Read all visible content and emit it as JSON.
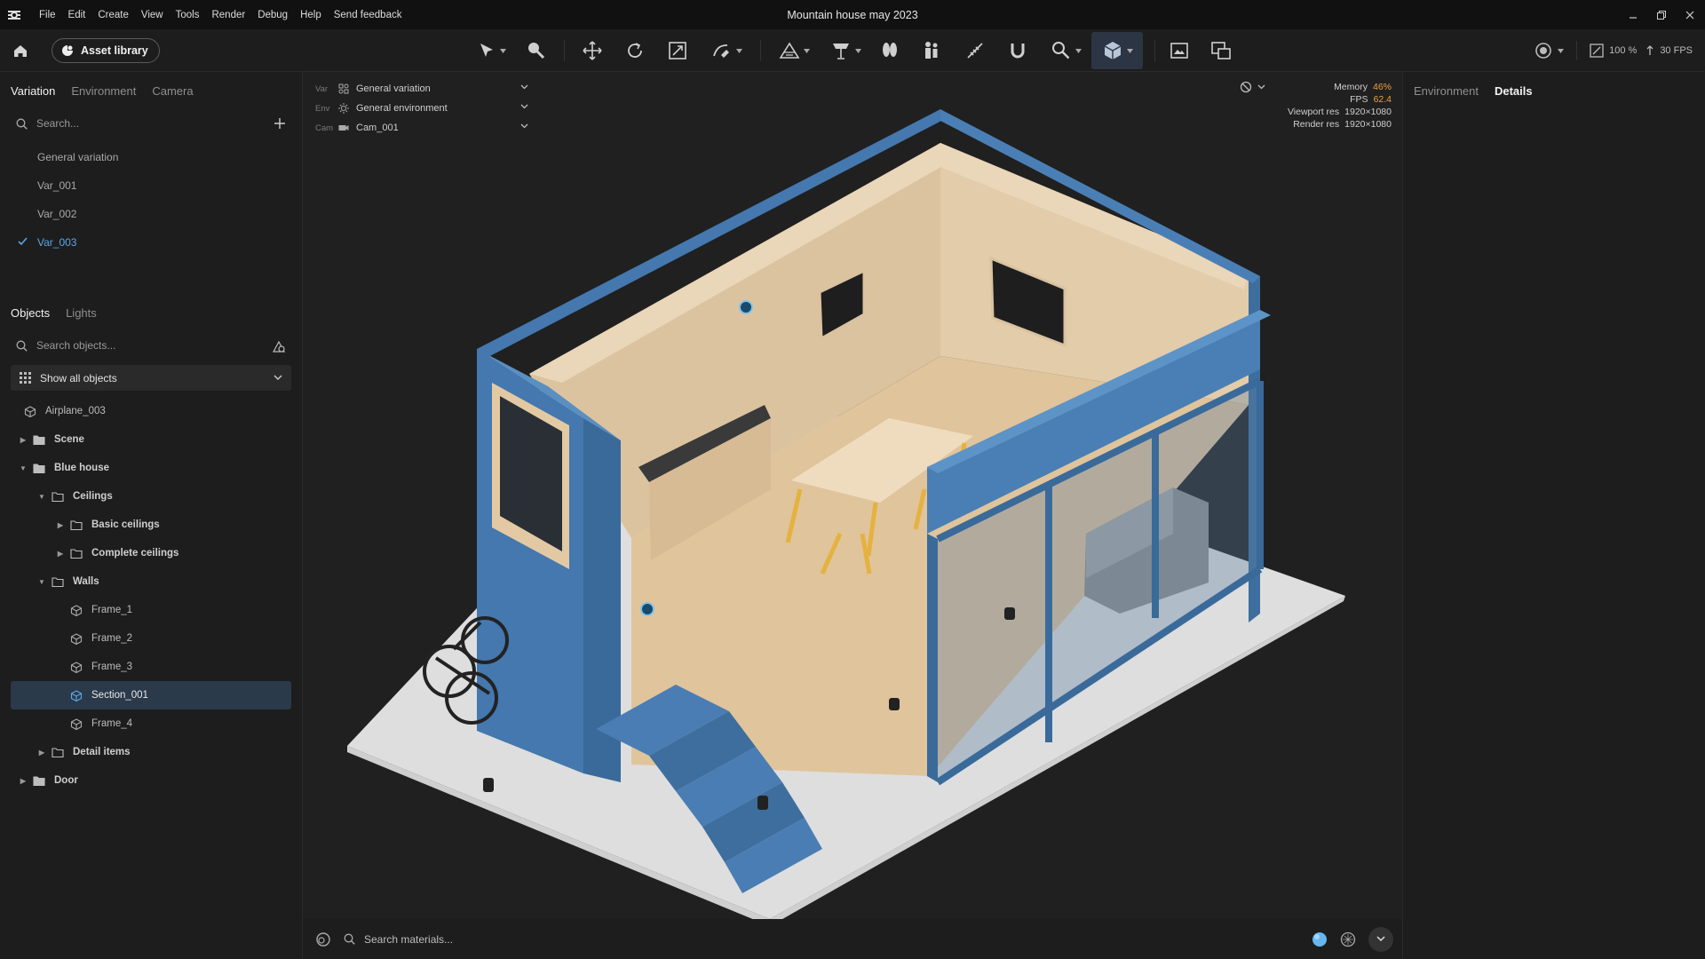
{
  "window": {
    "title": "Mountain house may 2023"
  },
  "menu": [
    "File",
    "Edit",
    "Create",
    "View",
    "Tools",
    "Render",
    "Debug",
    "Help",
    "Send feedback"
  ],
  "toolbar": {
    "asset_library": "Asset library",
    "icons": [
      "select-arrow-icon",
      "paint-select-icon",
      "move-icon",
      "rotate-icon",
      "scale-icon",
      "sketch-tool-icon",
      "terrain-icon",
      "lamp-icon",
      "vegetation-icon",
      "people-icon",
      "measure-icon",
      "magnet-icon",
      "search-tool-icon",
      "cube-view-icon",
      "screenshot-icon",
      "render-compare-icon"
    ],
    "zoom": "100 %",
    "fps_cap": "30 FPS"
  },
  "left": {
    "tabs": [
      "Variation",
      "Environment",
      "Camera"
    ],
    "search_placeholder": "Search...",
    "variations": [
      {
        "label": "General variation",
        "selected": false
      },
      {
        "label": "Var_001",
        "selected": false
      },
      {
        "label": "Var_002",
        "selected": false
      },
      {
        "label": "Var_003",
        "selected": true
      }
    ],
    "object_tabs": [
      "Objects",
      "Lights"
    ],
    "search_objects_placeholder": "Search objects...",
    "filter": "Show all objects",
    "tree": [
      {
        "label": "Airplane_003",
        "type": "object",
        "level": 0,
        "twisty": "",
        "bold": false,
        "selected": false
      },
      {
        "label": "Scene",
        "type": "folder",
        "level": 0,
        "twisty": "closed",
        "bold": true,
        "selected": false
      },
      {
        "label": "Blue house",
        "type": "folder",
        "level": 0,
        "twisty": "open",
        "bold": true,
        "selected": false
      },
      {
        "label": "Ceilings",
        "type": "folder",
        "level": 1,
        "twisty": "open",
        "bold": true,
        "selected": false
      },
      {
        "label": "Basic ceilings",
        "type": "folder",
        "level": 2,
        "twisty": "closed",
        "bold": true,
        "selected": false
      },
      {
        "label": "Complete ceilings",
        "type": "folder",
        "level": 2,
        "twisty": "closed",
        "bold": true,
        "selected": false
      },
      {
        "label": "Walls",
        "type": "folder",
        "level": 1,
        "twisty": "open",
        "bold": true,
        "selected": false
      },
      {
        "label": "Frame_1",
        "type": "object",
        "level": 2,
        "twisty": "",
        "bold": false,
        "selected": false
      },
      {
        "label": "Frame_2",
        "type": "object",
        "level": 2,
        "twisty": "",
        "bold": false,
        "selected": false
      },
      {
        "label": "Frame_3",
        "type": "object",
        "level": 2,
        "twisty": "",
        "bold": false,
        "selected": false
      },
      {
        "label": "Section_001",
        "type": "object",
        "level": 2,
        "twisty": "",
        "bold": false,
        "selected": true
      },
      {
        "label": "Frame_4",
        "type": "object",
        "level": 2,
        "twisty": "",
        "bold": false,
        "selected": false
      },
      {
        "label": "Detail items",
        "type": "folder",
        "level": 1,
        "twisty": "closed",
        "bold": true,
        "selected": false
      },
      {
        "label": "Door",
        "type": "folder",
        "level": 0,
        "twisty": "closed",
        "bold": true,
        "selected": false
      }
    ]
  },
  "viewport": {
    "selectors": [
      {
        "prefix": "Var",
        "value": "General variation",
        "icon": "variation-icon"
      },
      {
        "prefix": "Env",
        "value": "General environment",
        "icon": "environment-icon"
      },
      {
        "prefix": "Cam",
        "value": "Cam_001",
        "icon": "camera-icon"
      }
    ],
    "stats": {
      "memory_label": "Memory",
      "memory_value": "46%",
      "fps_label": "FPS",
      "fps_value": "62.4",
      "viewport_res_label": "Viewport res",
      "viewport_res_value": "1920×1080",
      "render_res_label": "Render res",
      "render_res_value": "1920×1080"
    }
  },
  "bottom": {
    "search_placeholder": "Search materials..."
  },
  "right": {
    "tabs": [
      "Environment",
      "Details"
    ],
    "active": "Details"
  },
  "colors": {
    "accent": "#5aa7ea",
    "house_blue": "#3d6e9e",
    "wood": "#e3c9a3",
    "warn": "#e8a046"
  }
}
